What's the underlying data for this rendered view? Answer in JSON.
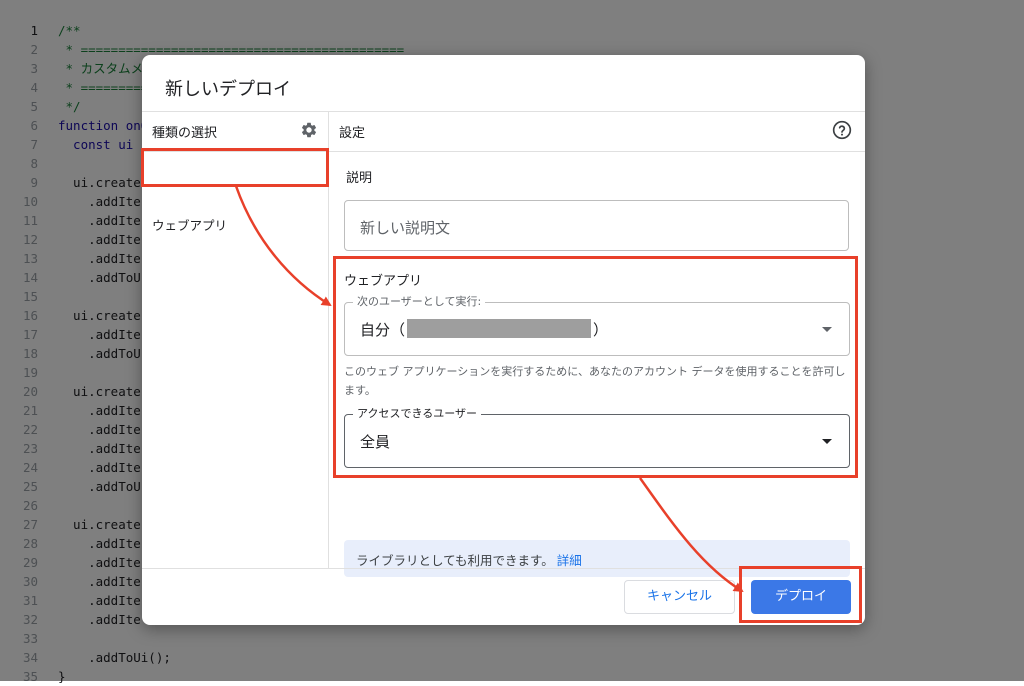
{
  "editor": {
    "lines": [
      {
        "n": "1",
        "text": "/**",
        "kind": "c"
      },
      {
        "n": "2",
        "text": " * ===========================================",
        "kind": "c"
      },
      {
        "n": "3",
        "text": " * カスタムメ",
        "kind": "c"
      },
      {
        "n": "4",
        "text": " * ==========",
        "kind": "c"
      },
      {
        "n": "5",
        "text": " */",
        "kind": "c"
      },
      {
        "n": "6",
        "text": "function onO",
        "kind": "k"
      },
      {
        "n": "7",
        "text": "  const ui",
        "kind": "k"
      },
      {
        "n": "8",
        "text": "",
        "kind": "t"
      },
      {
        "n": "9",
        "text": "  ui.create",
        "kind": "t"
      },
      {
        "n": "10",
        "text": "    .addIte",
        "kind": "t"
      },
      {
        "n": "11",
        "text": "    .addIte",
        "kind": "t"
      },
      {
        "n": "12",
        "text": "    .addIte",
        "kind": "t"
      },
      {
        "n": "13",
        "text": "    .addIte",
        "kind": "t"
      },
      {
        "n": "14",
        "text": "    .addToU",
        "kind": "t"
      },
      {
        "n": "15",
        "text": "",
        "kind": "t"
      },
      {
        "n": "16",
        "text": "  ui.create",
        "kind": "t"
      },
      {
        "n": "17",
        "text": "    .addIte",
        "kind": "t"
      },
      {
        "n": "18",
        "text": "    .addToU",
        "kind": "t"
      },
      {
        "n": "19",
        "text": "",
        "kind": "t"
      },
      {
        "n": "20",
        "text": "  ui.create",
        "kind": "t"
      },
      {
        "n": "21",
        "text": "    .addIte",
        "kind": "t"
      },
      {
        "n": "22",
        "text": "    .addIte",
        "kind": "t"
      },
      {
        "n": "23",
        "text": "    .addIte",
        "kind": "t"
      },
      {
        "n": "24",
        "text": "    .addIte",
        "kind": "t"
      },
      {
        "n": "25",
        "text": "    .addToU",
        "kind": "t"
      },
      {
        "n": "26",
        "text": "",
        "kind": "t"
      },
      {
        "n": "27",
        "text": "  ui.create",
        "kind": "t"
      },
      {
        "n": "28",
        "text": "    .addIte",
        "kind": "t"
      },
      {
        "n": "29",
        "text": "    .addIte",
        "kind": "t"
      },
      {
        "n": "30",
        "text": "    .addIte",
        "kind": "t"
      },
      {
        "n": "31",
        "text": "    .addIte",
        "kind": "t"
      },
      {
        "n": "32",
        "text": "    .addIte",
        "kind": "t"
      },
      {
        "n": "33",
        "text": "",
        "kind": "t"
      },
      {
        "n": "34",
        "text": "    .addToUi();",
        "kind": "t"
      },
      {
        "n": "35",
        "text": "}",
        "kind": "t"
      }
    ]
  },
  "dialog": {
    "title": "新しいデプロイ",
    "left": {
      "heading": "種類の選択",
      "items": [
        "ウェブアプリ"
      ]
    },
    "right": {
      "heading": "設定",
      "description_label": "説明",
      "description_placeholder": "新しい説明文",
      "webapp_section_title": "ウェブアプリ",
      "execute_as": {
        "label": "次のユーザーとして実行:",
        "value_prefix": "自分（",
        "value_suffix": "）"
      },
      "hint": "このウェブ アプリケーションを実行するために、あなたのアカウント データを使用することを許可します。",
      "access": {
        "label": "アクセスできるユーザー",
        "value": "全員"
      },
      "info_text": "ライブラリとしても利用できます。",
      "info_link": "詳細"
    },
    "footer": {
      "cancel": "キャンセル",
      "deploy": "デプロイ"
    }
  },
  "colors": {
    "annotation": "#e8402a",
    "primary": "#3b78e7",
    "info_bg": "#e8eefb"
  }
}
